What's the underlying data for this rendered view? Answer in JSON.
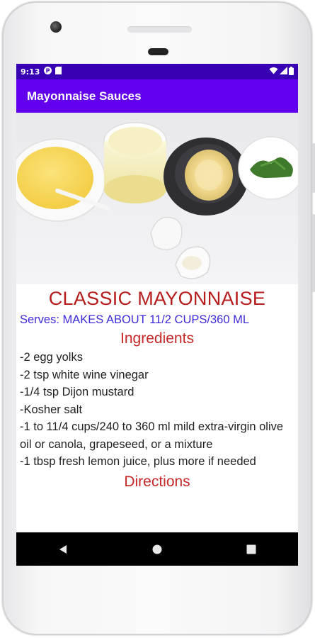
{
  "status_bar": {
    "time": "9:13",
    "icons": [
      "notification-p-icon",
      "sd-card-icon",
      "wifi-icon",
      "signal-icon",
      "battery-icon"
    ]
  },
  "app_bar": {
    "title": "Mayonnaise Sauces"
  },
  "recipe": {
    "title": "CLASSIC MAYONNAISE",
    "serves": "Serves: MAKES ABOUT 11/2 CUPS/360 ML",
    "ingredients_heading": "Ingredients",
    "ingredients": [
      "-2 egg yolks",
      "-2 tsp white wine vinegar",
      "-1/4 tsp Dijon mustard",
      "-Kosher salt",
      "-1 to 11/4 cups/240 to 360 ml mild extra-virgin olive oil or canola, grapeseed, or a mixture",
      "-1 tbsp fresh lemon juice, plus more if needed"
    ],
    "directions_heading": "Directions"
  },
  "nav_bar": {
    "buttons": [
      "back",
      "home",
      "recents"
    ]
  },
  "colors": {
    "status_bar": "#3700b3",
    "app_bar": "#6200ee",
    "title_red": "#b71c1c",
    "serves_blue": "#3d2bd8"
  }
}
